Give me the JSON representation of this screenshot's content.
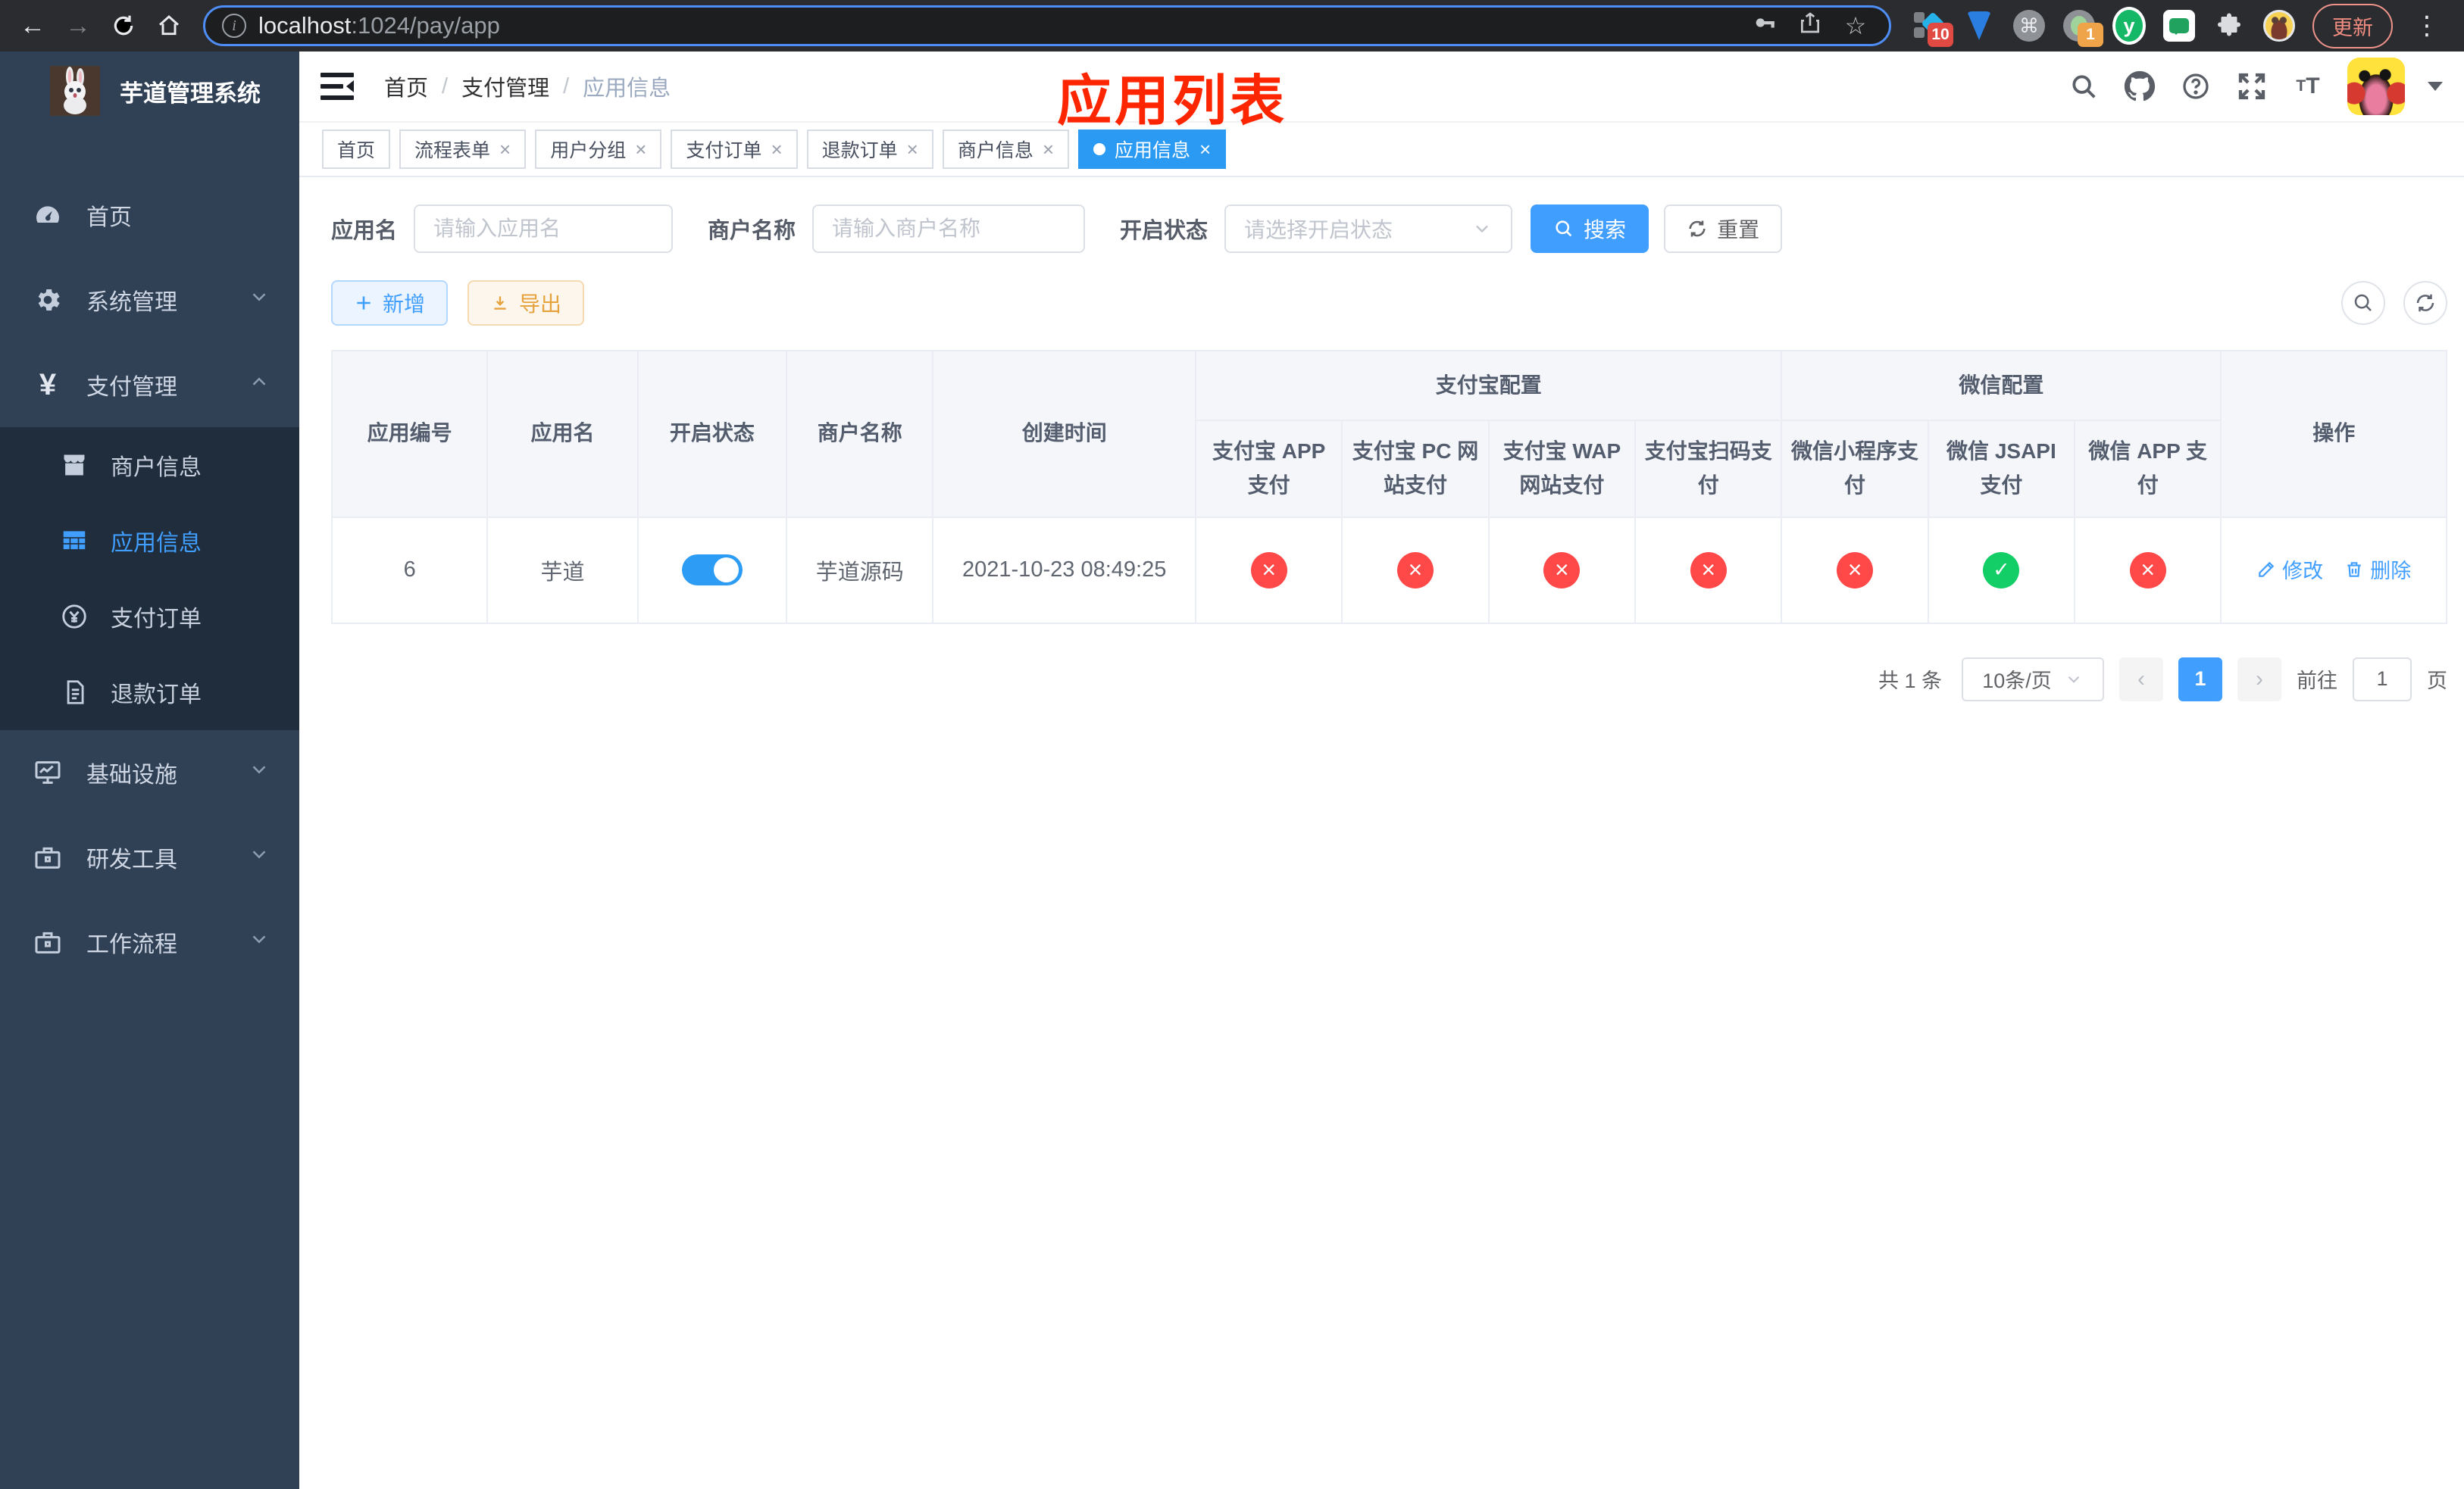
{
  "browser": {
    "url": {
      "host": "localhost",
      "path": ":1024/pay/app"
    },
    "update_button": "更新",
    "badges": {
      "pinned_ext": "10",
      "profile_ext": "1"
    },
    "ext_letter": "y",
    "command_glyph": "⌘"
  },
  "annotation": {
    "title": "应用列表"
  },
  "header": {
    "breadcrumb": {
      "home": "首页",
      "section": "支付管理",
      "current": "应用信息",
      "separator": "/"
    }
  },
  "tabs": [
    {
      "label": "首页"
    },
    {
      "label": "流程表单"
    },
    {
      "label": "用户分组"
    },
    {
      "label": "支付订单"
    },
    {
      "label": "退款订单"
    },
    {
      "label": "商户信息"
    },
    {
      "label": "应用信息"
    }
  ],
  "sidebar": {
    "title": "芋道管理系统",
    "menu": {
      "home": "首页",
      "system": "系统管理",
      "pay": "支付管理",
      "merchant": "商户信息",
      "app": "应用信息",
      "order": "支付订单",
      "refund": "退款订单",
      "infra": "基础设施",
      "dev": "研发工具",
      "workflow": "工作流程"
    }
  },
  "filters": {
    "app_name": {
      "label": "应用名",
      "placeholder": "请输入应用名",
      "value": ""
    },
    "merchant_name": {
      "label": "商户名称",
      "placeholder": "请输入商户名称",
      "value": ""
    },
    "status": {
      "label": "开启状态",
      "placeholder": "请选择开启状态"
    },
    "search": "搜索",
    "reset": "重置"
  },
  "toolbar": {
    "add": "新增",
    "export": "导出"
  },
  "table": {
    "columns": {
      "app_id": "应用编号",
      "app_name": "应用名",
      "status": "开启状态",
      "merchant": "商户名称",
      "created": "创建时间",
      "actions": "操作"
    },
    "groups": {
      "alipay": {
        "label": "支付宝配置",
        "children": [
          "支付宝 APP 支付",
          "支付宝 PC 网站支付",
          "支付宝 WAP 网站支付",
          "支付宝扫码支付"
        ]
      },
      "wechat": {
        "label": "微信配置",
        "children": [
          "微信小程序支付",
          "微信 JSAPI 支付",
          "微信 APP 支付"
        ]
      }
    },
    "rows": [
      {
        "app_id": "6",
        "app_name": "芋道",
        "enabled": "on",
        "merchant": "芋道源码",
        "created": "2021-10-23 08:49:25",
        "channels": [
          "off",
          "off",
          "off",
          "off",
          "off",
          "on",
          "off"
        ],
        "edit": "修改",
        "delete": "删除"
      }
    ]
  },
  "pagination": {
    "total": "共 1 条",
    "page_size": "10条/页",
    "prev": "‹",
    "next": "›",
    "current_page": "1",
    "goto_label": "前往",
    "goto_value": "1",
    "page_unit": "页"
  },
  "colors": {
    "primary": "#409eff",
    "success": "#13ce66",
    "danger": "#ff4949",
    "warning": "#e6a23c",
    "sidebar": "#304156",
    "submenu": "#1f2d3d"
  }
}
